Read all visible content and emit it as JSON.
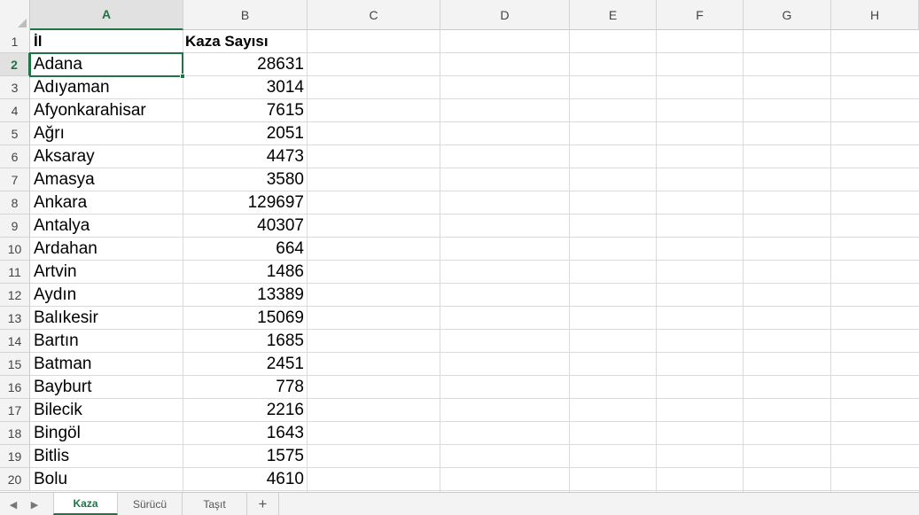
{
  "columns": [
    "A",
    "B",
    "C",
    "D",
    "E",
    "F",
    "G",
    "H"
  ],
  "selected_column": "A",
  "selected_row": 2,
  "header_row": {
    "row": 1,
    "a": "İl",
    "b": "Kaza Sayısı"
  },
  "rows": [
    {
      "row": 2,
      "il": "Adana",
      "kaza": "28631"
    },
    {
      "row": 3,
      "il": "Adıyaman",
      "kaza": "3014"
    },
    {
      "row": 4,
      "il": "Afyonkarahisar",
      "kaza": "7615"
    },
    {
      "row": 5,
      "il": "Ağrı",
      "kaza": "2051"
    },
    {
      "row": 6,
      "il": "Aksaray",
      "kaza": "4473"
    },
    {
      "row": 7,
      "il": "Amasya",
      "kaza": "3580"
    },
    {
      "row": 8,
      "il": "Ankara",
      "kaza": "129697"
    },
    {
      "row": 9,
      "il": "Antalya",
      "kaza": "40307"
    },
    {
      "row": 10,
      "il": "Ardahan",
      "kaza": "664"
    },
    {
      "row": 11,
      "il": "Artvin",
      "kaza": "1486"
    },
    {
      "row": 12,
      "il": "Aydın",
      "kaza": "13389"
    },
    {
      "row": 13,
      "il": "Balıkesir",
      "kaza": "15069"
    },
    {
      "row": 14,
      "il": "Bartın",
      "kaza": "1685"
    },
    {
      "row": 15,
      "il": "Batman",
      "kaza": "2451"
    },
    {
      "row": 16,
      "il": "Bayburt",
      "kaza": "778"
    },
    {
      "row": 17,
      "il": "Bilecik",
      "kaza": "2216"
    },
    {
      "row": 18,
      "il": "Bingöl",
      "kaza": "1643"
    },
    {
      "row": 19,
      "il": "Bitlis",
      "kaza": "1575"
    },
    {
      "row": 20,
      "il": "Bolu",
      "kaza": "4610"
    }
  ],
  "sheet_tabs": [
    "Kaza",
    "Sürücü",
    "Taşıt"
  ],
  "active_tab": "Kaza",
  "add_sheet_label": "+",
  "nav": {
    "prev_icon": "caret-left-icon",
    "next_icon": "caret-right-icon"
  },
  "colors": {
    "accent": "#217346",
    "header_bg": "#f3f3f3",
    "gridline": "#dadada"
  }
}
